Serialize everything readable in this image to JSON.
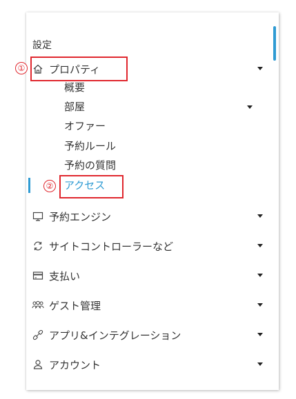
{
  "menu": {
    "section_title": "設定",
    "property": {
      "label": "プロパティ",
      "children": [
        "概要",
        "部屋",
        "オファー",
        "予約ルール",
        "予約の質問",
        "アクセス"
      ]
    },
    "items": [
      {
        "icon": "monitor-icon",
        "label": "予約エンジン"
      },
      {
        "icon": "sync-icon",
        "label": "サイトコントローラーなど"
      },
      {
        "icon": "credit-card-icon",
        "label": "支払い"
      },
      {
        "icon": "guests-icon",
        "label": "ゲスト管理"
      },
      {
        "icon": "plug-icon",
        "label": "アプリ&インテグレーション"
      },
      {
        "icon": "user-icon",
        "label": "アカウント"
      }
    ]
  },
  "annotations": {
    "marker_1": "①",
    "marker_2": "②"
  },
  "colors": {
    "accent": "#2f9bd3",
    "highlight_box": "#e0262d",
    "text": "#333333"
  }
}
